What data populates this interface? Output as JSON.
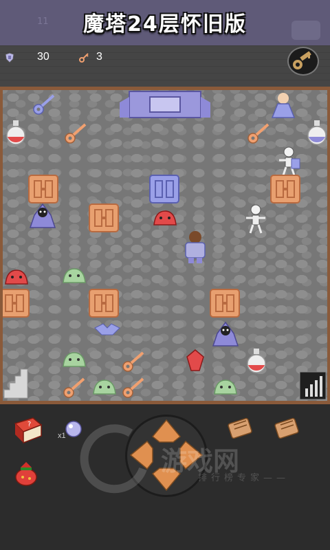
{
  "banner": {
    "title": "魔塔24层怀旧版",
    "ghost_level": "11"
  },
  "status": {
    "shield_value": "30",
    "key_count": "3"
  },
  "inventory": {
    "potion_count": "x1"
  },
  "watermark": {
    "main": "游戏网",
    "sub": "排行榜专家——"
  },
  "colors": {
    "banner": "#5f5a78",
    "board_frame": "#8a5a3a",
    "orange_door": "#e8a070",
    "blue_door": "#9aa0e8",
    "red_slime": "#e24a4a",
    "green_slime": "#a8d4a0"
  }
}
